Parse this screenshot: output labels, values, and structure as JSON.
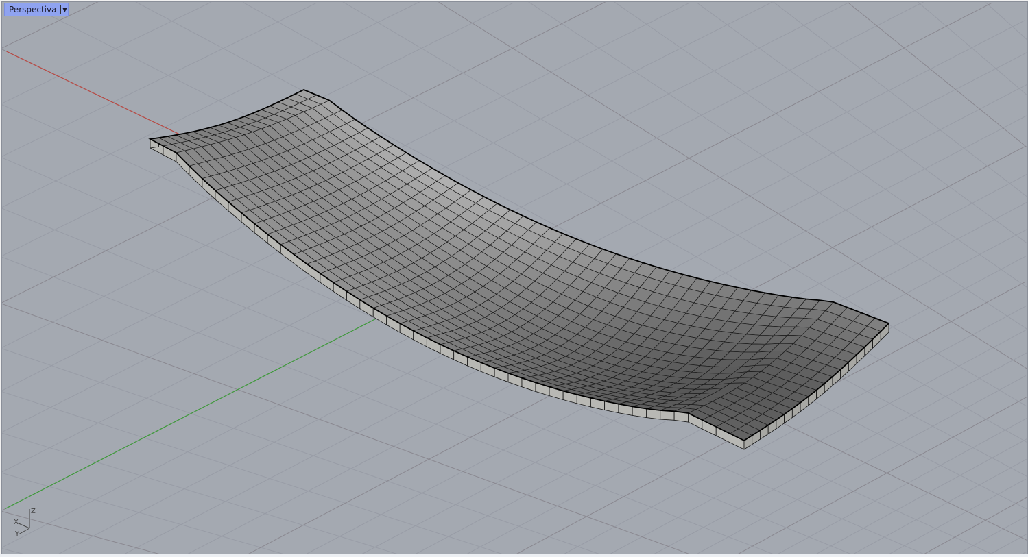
{
  "viewport": {
    "label": "Perspectiva",
    "menu_icon": "dropdown-arrow-icon",
    "background_color": "#a4a9b1",
    "x_axis_color": "#b84a44",
    "y_axis_color": "#3e9a3a",
    "axis_icon_labels": {
      "x": "X",
      "y": "Y",
      "z": "Z"
    }
  },
  "object": {
    "type": "thickened wavy surface",
    "fill_color": "#9c9c9c",
    "edge_color": "#000000"
  }
}
